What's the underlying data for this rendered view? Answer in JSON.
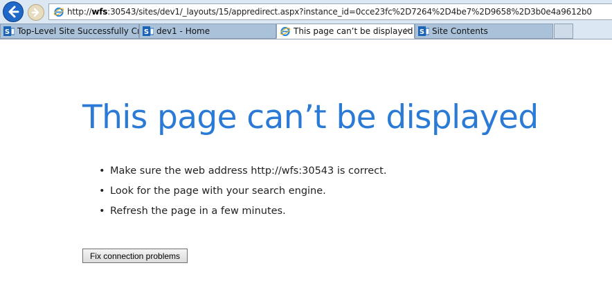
{
  "browser": {
    "address": {
      "prefix": "http://",
      "host": "wfs",
      "rest": ":30543/sites/dev1/_layouts/15/appredirect.aspx?instance_id=0cce23fc%2D7264%2D4be7%2D9658%2D3b0e4a9612b0"
    },
    "tabs": [
      {
        "label": "Top-Level Site Successfully Cre...",
        "icon": "sharepoint-icon",
        "active": false
      },
      {
        "label": "dev1 - Home",
        "icon": "sharepoint-icon",
        "active": false
      },
      {
        "label": "This page can’t be displayed",
        "icon": "internet-explorer-icon",
        "active": true
      },
      {
        "label": "Site Contents",
        "icon": "sharepoint-icon",
        "active": false
      }
    ],
    "close_glyph": "×"
  },
  "page": {
    "title": "This page can’t be displayed",
    "suggestions": [
      "Make sure the web address http://wfs:30543 is correct.",
      "Look for the page with your search engine.",
      "Refresh the page in a few minutes."
    ],
    "fix_button": "Fix connection problems"
  },
  "colors": {
    "title_blue": "#2b7bd6",
    "back_button_blue": "#1f68c7"
  }
}
